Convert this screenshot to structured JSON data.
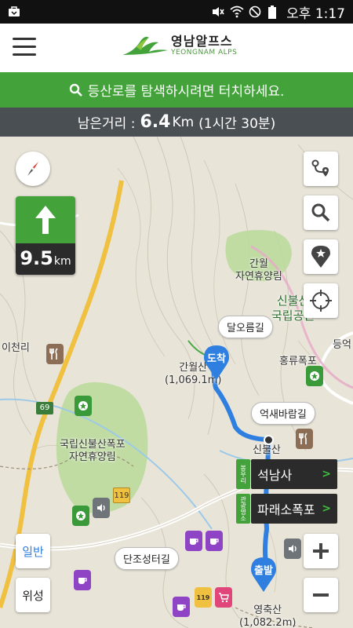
{
  "status_bar": {
    "time": "오후 1:17"
  },
  "app": {
    "logo_title": "영남알프스",
    "logo_subtitle": "YEONGNAM ALPS"
  },
  "search": {
    "text": "등산로를 탐색하시려면 터치하세요."
  },
  "distance": {
    "label": "남은거리 :",
    "value": "6.4",
    "unit": "Km",
    "time": "(1시간 30분)"
  },
  "navigation": {
    "distance_value": "9.5",
    "distance_unit": "km"
  },
  "map": {
    "labels": {
      "ganwol_forest": "간월\n자연휴양림",
      "sinbulsan_park": "신불산\n국립공원",
      "icheonri": "이천리",
      "ganwolsan": "간월산\n(1,069.1m)",
      "hongryu": "홍류폭포",
      "deung": "등억",
      "sinbulsan_forest": "국립신불산폭포\n자연휴양림",
      "sinbulsan": "신불산",
      "yeongchuksan": "영축산\n(1,082.2m)",
      "road_69": "69",
      "road_119": "119"
    },
    "bubbles": {
      "dalorum": "달오름길",
      "eoksae": "억새바람길",
      "danjo": "단조성터길"
    },
    "pins": {
      "end": "도착",
      "start": "출발"
    }
  },
  "route_list": [
    {
      "tag": "봉우리",
      "label": "석남사"
    },
    {
      "tag": "관광명소",
      "label": "파래소폭포"
    }
  ],
  "controls": {
    "mode_normal": "일반",
    "mode_satellite": "위성"
  },
  "colors": {
    "brand_green": "#43a33a",
    "route_blue": "#2f7fe0",
    "panel_dark": "#2b2b2b"
  }
}
